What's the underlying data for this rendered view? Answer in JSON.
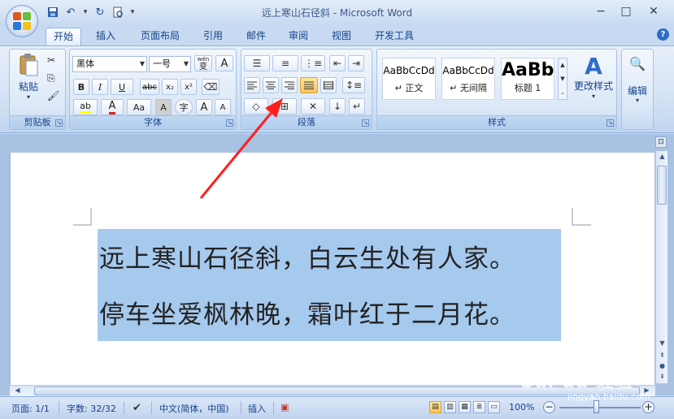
{
  "window": {
    "title": "远上寒山石径斜 - Microsoft Word",
    "controls": {
      "minimize": "−",
      "restore": "□",
      "close": "✕"
    }
  },
  "qat": {
    "save": "save-icon",
    "undo": "undo-icon",
    "redo": "redo-icon",
    "print_preview": "print-preview-icon",
    "customize": "▾"
  },
  "tabs": [
    {
      "label": "开始",
      "active": true
    },
    {
      "label": "插入"
    },
    {
      "label": "页面布局"
    },
    {
      "label": "引用"
    },
    {
      "label": "邮件"
    },
    {
      "label": "审阅"
    },
    {
      "label": "视图"
    },
    {
      "label": "开发工具"
    }
  ],
  "ribbon": {
    "clipboard": {
      "paste_label": "粘贴",
      "group_label": "剪贴板"
    },
    "font": {
      "font_name": "黑体",
      "font_size": "一号",
      "wen_label": "wén",
      "wen_char": "变",
      "a_box": "A",
      "bold": "B",
      "italic": "I",
      "underline": "U",
      "strike": "abc",
      "subscript": "x₂",
      "superscript": "x²",
      "font_color": "A",
      "change_case": "Aa",
      "char_shade": "A",
      "enclose": "字",
      "grow": "A",
      "shrink": "A",
      "group_label": "字体"
    },
    "paragraph": {
      "group_label": "段落"
    },
    "styles": {
      "cards": [
        {
          "preview": "AaBbCcDd",
          "name": "↵ 正文"
        },
        {
          "preview": "AaBbCcDd",
          "name": "↵ 无间隔"
        },
        {
          "preview": "AaBb",
          "name": "标题 1"
        }
      ],
      "change_styles_label": "更改样式",
      "group_label": "样式"
    },
    "editing": {
      "label": "编辑"
    }
  },
  "document": {
    "lines": [
      "远上寒山石径斜，白云生处有人家。",
      "停车坐爱枫林晚，霜叶红于二月花。"
    ]
  },
  "status": {
    "page": "页面: 1/1",
    "words": "字数: 32/32",
    "language": "中文(简体，中国)",
    "mode": "插入",
    "zoom": "100%"
  },
  "watermark": {
    "logo": "Bai du 经验",
    "url": "jingyan.baidu.com"
  }
}
